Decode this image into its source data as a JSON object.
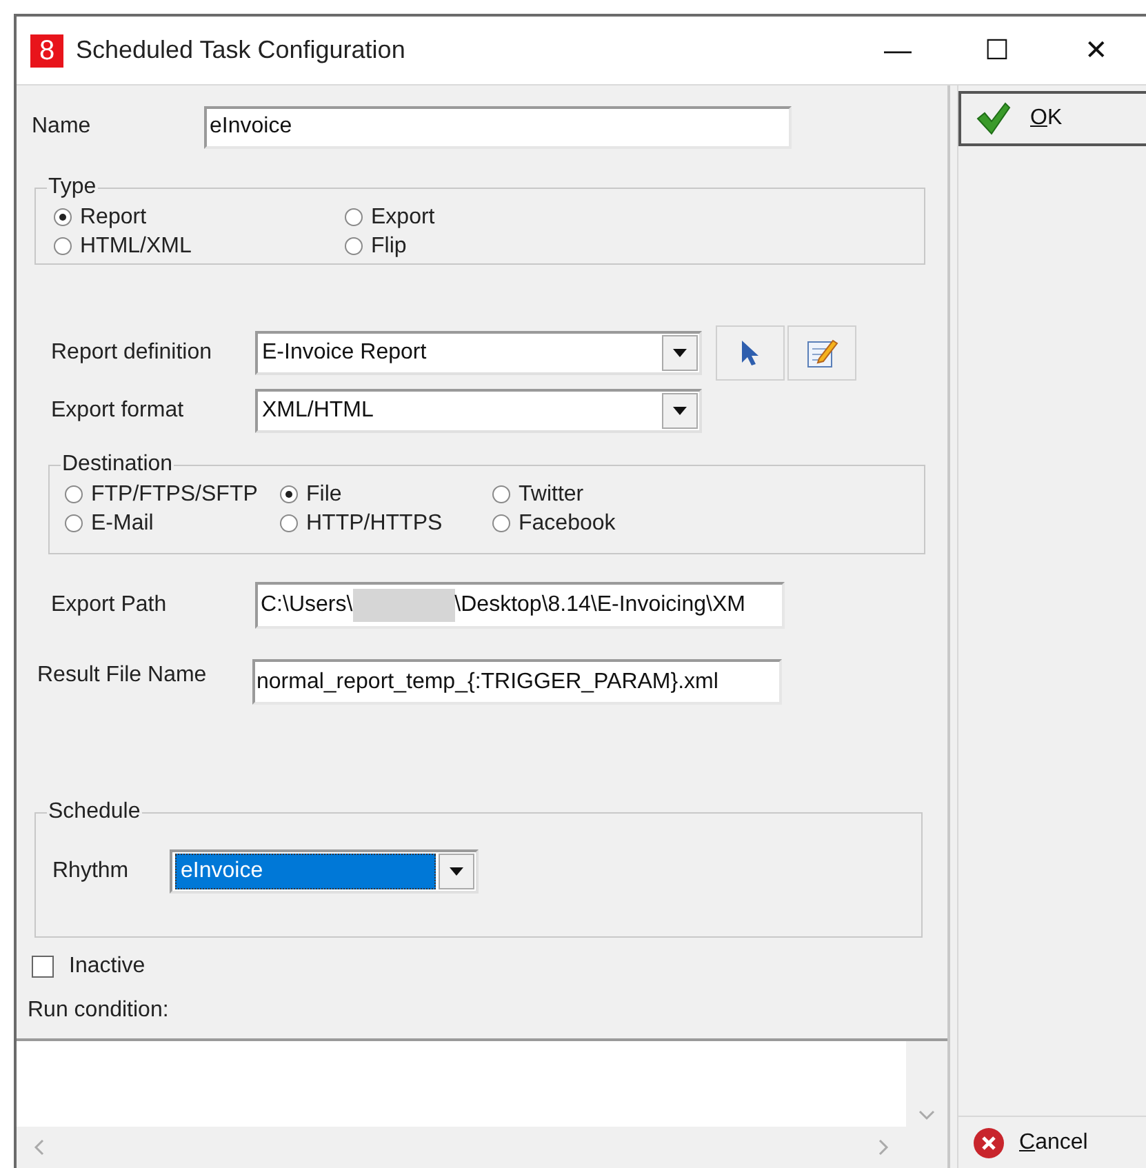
{
  "window": {
    "logo": "8",
    "title": "Scheduled Task Configuration",
    "controls": [
      "—",
      "☐",
      "✕"
    ]
  },
  "name": {
    "label": "Name",
    "value": "eInvoice"
  },
  "type_group": {
    "title": "Type",
    "options": [
      {
        "label": "Report",
        "selected": true
      },
      {
        "label": "Export",
        "selected": false
      },
      {
        "label": "HTML/XML",
        "selected": false
      },
      {
        "label": "Flip",
        "selected": false
      }
    ]
  },
  "report_definition": {
    "label": "Report definition",
    "value": "E-Invoice Report"
  },
  "export_format": {
    "label": "Export format",
    "value": "XML/HTML"
  },
  "destination_group": {
    "title": "Destination",
    "options": [
      {
        "label": "FTP/FTPS/SFTP",
        "selected": false
      },
      {
        "label": "File",
        "selected": true
      },
      {
        "label": "Twitter",
        "selected": false
      },
      {
        "label": "E-Mail",
        "selected": false
      },
      {
        "label": "HTTP/HTTPS",
        "selected": false
      },
      {
        "label": "Facebook",
        "selected": false
      }
    ]
  },
  "export_path": {
    "label": "Export Path",
    "value_before_redaction": "C:\\Users\\",
    "value_after_redaction": "\\Desktop\\8.14\\E-Invoicing\\XM"
  },
  "result_file_name": {
    "label": "Result File Name",
    "value": "normal_report_temp_{:TRIGGER_PARAM}.xml"
  },
  "schedule_group": {
    "title": "Schedule",
    "rhythm_label": "Rhythm",
    "rhythm_value": "eInvoice"
  },
  "inactive": {
    "label": "Inactive",
    "checked": false
  },
  "run_condition": {
    "label": "Run condition:"
  },
  "buttons": [
    {
      "label": "OK",
      "kind": "ok"
    },
    {
      "label": "Cancel",
      "kind": "cancel"
    }
  ]
}
